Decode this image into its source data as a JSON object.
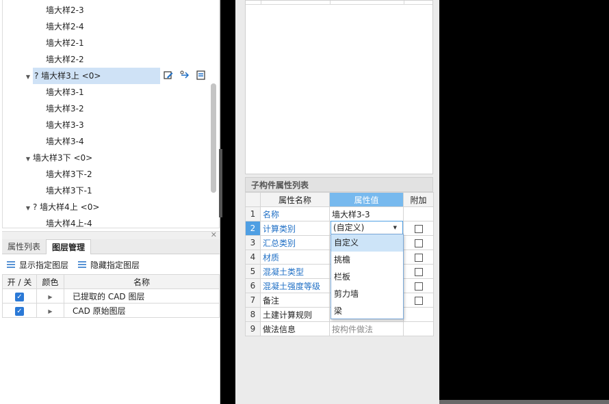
{
  "tree": {
    "items": [
      {
        "label": "墙大样2-3",
        "level": 2
      },
      {
        "label": "墙大样2-4",
        "level": 2
      },
      {
        "label": "墙大样2-1",
        "level": 2
      },
      {
        "label": "墙大样2-2",
        "level": 2
      },
      {
        "label": "? 墙大样3上 <0>",
        "level": 1,
        "expanded": true,
        "selected": true
      },
      {
        "label": "墙大样3-1",
        "level": 2
      },
      {
        "label": "墙大样3-2",
        "level": 2
      },
      {
        "label": "墙大样3-3",
        "level": 2
      },
      {
        "label": "墙大样3-4",
        "level": 2
      },
      {
        "label": "墙大样3下 <0>",
        "level": 1,
        "expanded": true
      },
      {
        "label": "墙大样3下-2",
        "level": 2
      },
      {
        "label": "墙大样3下-1",
        "level": 2
      },
      {
        "label": "? 墙大样4上 <0>",
        "level": 1,
        "expanded": true
      },
      {
        "label": "墙大样4上-4",
        "level": 2
      }
    ],
    "row_icons": [
      "edit-icon",
      "link-icon",
      "list-icon"
    ]
  },
  "bottom_tabs": {
    "tabs": [
      "属性列表",
      "图层管理"
    ],
    "active": "图层管理"
  },
  "layer_tools": {
    "show": "显示指定图层",
    "hide": "隐藏指定图层"
  },
  "layer_table": {
    "headers": [
      "开 / 关",
      "颜色",
      "名称"
    ],
    "rows": [
      {
        "checked": true,
        "name": "已提取的 CAD 图层"
      },
      {
        "checked": true,
        "name": "CAD 原始图层"
      }
    ]
  },
  "sub_props": {
    "title": "子构件属性列表",
    "headers": [
      "属性名称",
      "属性值",
      "附加"
    ],
    "rows": [
      {
        "num": "1",
        "name": "名称",
        "value": "墙大样3-3",
        "blue": true,
        "checkbox": false
      },
      {
        "num": "2",
        "name": "计算类别",
        "value": "",
        "blue": true,
        "checkbox": true,
        "selected": true
      },
      {
        "num": "3",
        "name": "汇总类别",
        "value": "",
        "blue": true,
        "checkbox": true
      },
      {
        "num": "4",
        "name": "材质",
        "value": "",
        "blue": true,
        "checkbox": true
      },
      {
        "num": "5",
        "name": "混凝土类型",
        "value": "",
        "blue": true,
        "checkbox": true
      },
      {
        "num": "6",
        "name": "混凝土强度等级",
        "value": "",
        "blue": true,
        "checkbox": true
      },
      {
        "num": "7",
        "name": "备注",
        "value": "",
        "blue": false,
        "checkbox": true
      },
      {
        "num": "8",
        "name": "土建计算规则",
        "value": "",
        "blue": false,
        "checkbox": false
      },
      {
        "num": "9",
        "name": "做法信息",
        "value": "按构件做法",
        "blue": false,
        "checkbox": false,
        "gray": true
      }
    ],
    "combo_value": "(自定义)",
    "dropdown_options": [
      "自定义",
      "挑檐",
      "栏板",
      "剪力墙",
      "梁"
    ],
    "dropdown_active": "自定义"
  },
  "colors": {
    "selection": "#cfe2f6",
    "header_active": "#77b9ee",
    "checkbox": "#2b79d6",
    "link_text": "#1f6fc5"
  }
}
